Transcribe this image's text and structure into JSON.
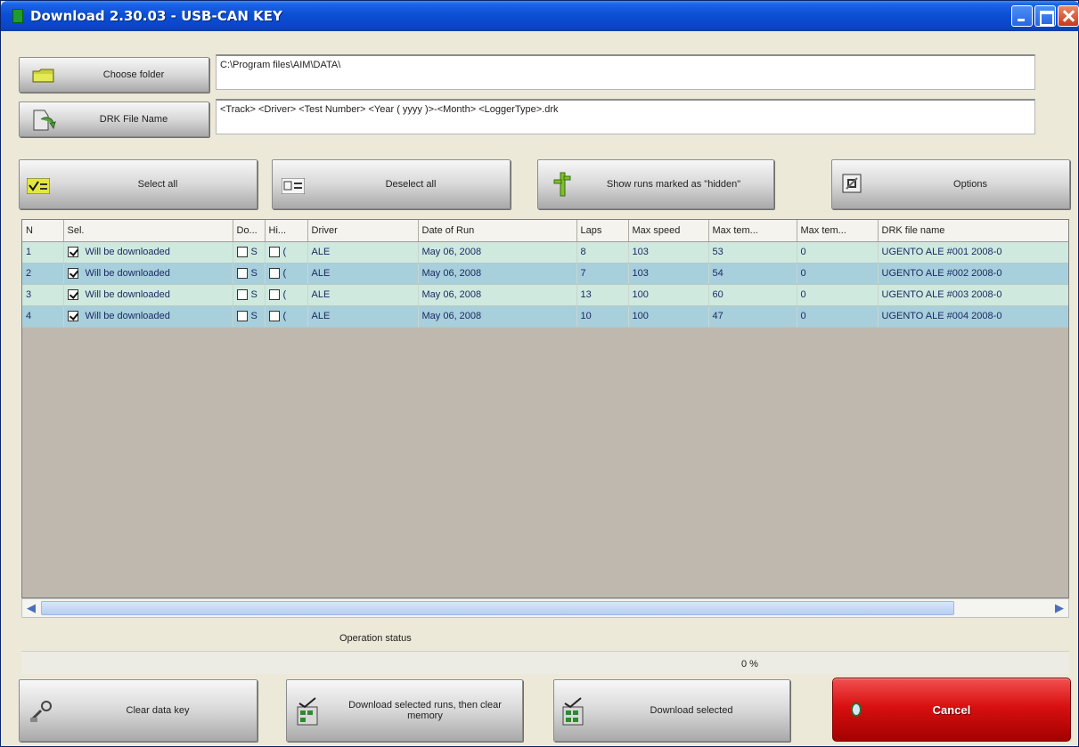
{
  "window": {
    "title": "Download 2.30.03 - USB-CAN KEY"
  },
  "top": {
    "choose_folder_label": "Choose folder",
    "folder_path": "C:\\Program files\\AIM\\DATA\\",
    "drk_name_label": "DRK File Name",
    "drk_pattern": "<Track> <Driver> <Test Number> <Year ( yyyy )>-<Month> <LoggerType>.drk"
  },
  "toolbar": {
    "select_all": "Select all",
    "deselect_all": "Deselect all",
    "show_hidden": "Show runs marked as \"hidden\"",
    "options": "Options"
  },
  "table": {
    "columns": [
      "N",
      "Sel.",
      "Do...",
      "Hi...",
      "Driver",
      "Date of Run",
      "Laps",
      "Max speed",
      "Max tem...",
      "Max tem...",
      "DRK file name"
    ],
    "rows": [
      {
        "n": "1",
        "sel": "Will be downloaded",
        "do": "S",
        "hi": "(",
        "driver": "ALE",
        "date": "May 06, 2008",
        "laps": "8",
        "max_speed": "103",
        "max_temp1": "53",
        "max_temp2": "0",
        "file": "UGENTO ALE #001 2008-0"
      },
      {
        "n": "2",
        "sel": "Will be downloaded",
        "do": "S",
        "hi": "(",
        "driver": "ALE",
        "date": "May 06, 2008",
        "laps": "7",
        "max_speed": "103",
        "max_temp1": "54",
        "max_temp2": "0",
        "file": "UGENTO ALE #002 2008-0"
      },
      {
        "n": "3",
        "sel": "Will be downloaded",
        "do": "S",
        "hi": "(",
        "driver": "ALE",
        "date": "May 06, 2008",
        "laps": "13",
        "max_speed": "100",
        "max_temp1": "60",
        "max_temp2": "0",
        "file": "UGENTO ALE #003 2008-0"
      },
      {
        "n": "4",
        "sel": "Will be downloaded",
        "do": "S",
        "hi": "(",
        "driver": "ALE",
        "date": "May 06, 2008",
        "laps": "10",
        "max_speed": "100",
        "max_temp1": "47",
        "max_temp2": "0",
        "file": "UGENTO ALE #004 2008-0"
      }
    ]
  },
  "status": {
    "label": "Operation status",
    "progress_fraction": 0,
    "percent_text": "0 %"
  },
  "bottom": {
    "clear_key": "Clear data key",
    "download_then_clear": "Download selected runs, then clear memory",
    "download_selected": "Download selected",
    "cancel": "Cancel"
  },
  "colors": {
    "row_odd": "#cfe9df",
    "row_even": "#a8cfdc",
    "cancel_red": "#d81010",
    "titlebar_blue": "#0b4fd6"
  }
}
